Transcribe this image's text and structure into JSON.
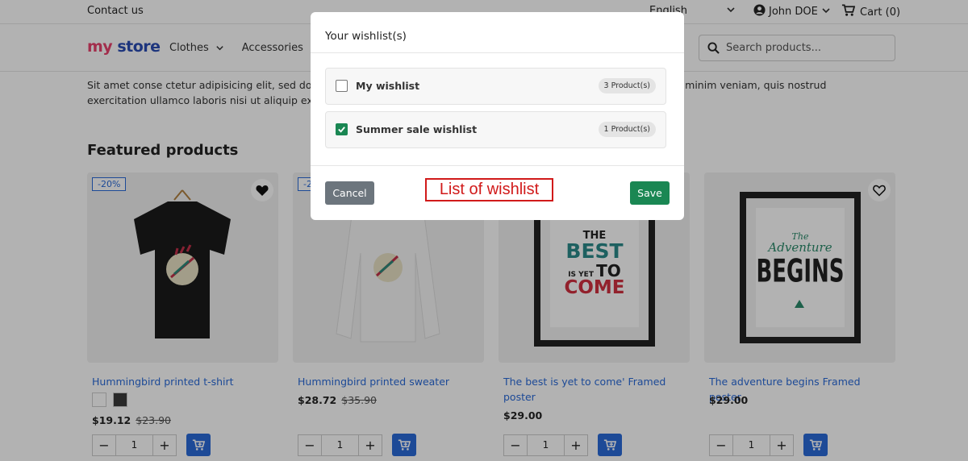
{
  "topbar": {
    "contact": "Contact us",
    "language": "English",
    "user": "John DOE",
    "cart": "Cart (0)"
  },
  "header": {
    "logo_part1": "my",
    "logo_part2": "store",
    "nav": [
      "Clothes",
      "Accessories"
    ],
    "search_placeholder": "Search products..."
  },
  "content": {
    "description": "Sit amet conse ctetur adipisicing elit, sed do eiusmod tempor incididunt ut labore et dolore magna aliqua. Ut enim ad minim veniam, quis nostrud exercitation ullamco laboris nisi ut aliquip ex ea commodo consequat.",
    "featured_title": "Featured products"
  },
  "products": [
    {
      "name": "Hummingbird printed t-shirt",
      "price": "$19.12",
      "old_price": "$23.90",
      "discount": "-20%",
      "qty": "1",
      "colors": [
        "#ffffff",
        "#3a3a3a"
      ]
    },
    {
      "name": "Hummingbird printed sweater",
      "price": "$28.72",
      "old_price": "$35.90",
      "discount": "-20%",
      "qty": "1"
    },
    {
      "name": "The best is yet to come' Framed poster",
      "price": "$29.00",
      "qty": "1",
      "poster_text": [
        "THE",
        "BEST",
        "IS YET",
        "TO",
        "COME"
      ]
    },
    {
      "name": "The adventure begins Framed poster",
      "price": "$29.00",
      "qty": "1",
      "poster_text": [
        "The",
        "Adventure",
        "BEGINS"
      ]
    }
  ],
  "modal": {
    "title": "Your wishlist(s)",
    "wishlists": [
      {
        "name": "My wishlist",
        "count": "3 Product(s)",
        "checked": false
      },
      {
        "name": "Summer sale wishlist",
        "count": "1 Product(s)",
        "checked": true
      }
    ],
    "cancel": "Cancel",
    "save": "Save",
    "annotation": "List of wishlist"
  },
  "colors": {
    "accent": "#2a6ad8",
    "save": "#1a8753",
    "cancel": "#6c757d",
    "annotation": "#d11a1a"
  },
  "icons": [
    "user-icon",
    "cart-icon",
    "chevron-down-icon",
    "search-icon",
    "heart-icon",
    "add-to-cart-icon",
    "checkbox-icon"
  ]
}
